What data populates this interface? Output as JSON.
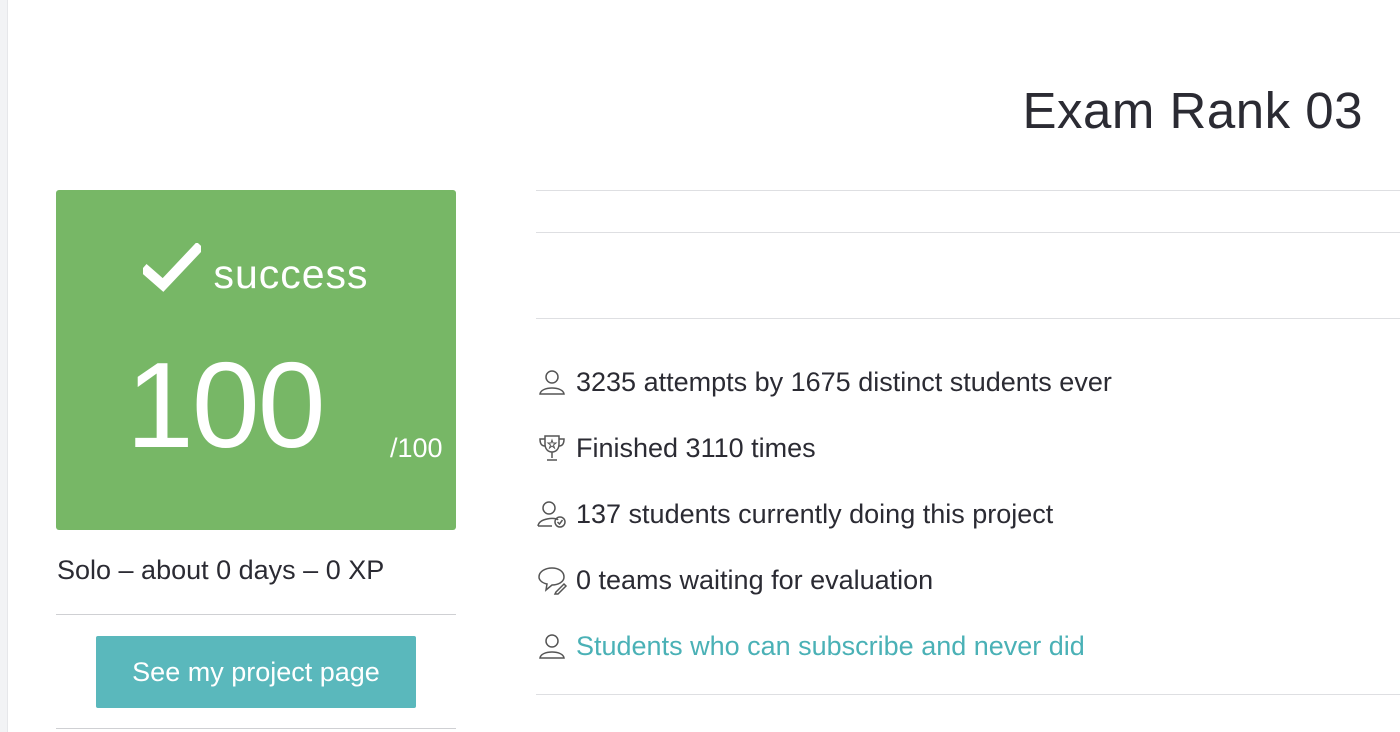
{
  "page": {
    "title": "Exam Rank 03"
  },
  "grade": {
    "status": "success",
    "score": "100",
    "max_score": "/100",
    "accent_color": "#77b766"
  },
  "project": {
    "meta": "Solo – about 0 days – 0 XP",
    "button_label": "See my project page",
    "button_color": "#5ab8bc"
  },
  "stats": [
    {
      "icon": "user-icon",
      "text": "3235 attempts by 1675 distinct students ever"
    },
    {
      "icon": "trophy-icon",
      "text": "Finished 3110 times"
    },
    {
      "icon": "user-check-icon",
      "text": "137 students currently doing this project"
    },
    {
      "icon": "chat-bubbles-icon",
      "text": "0 teams waiting for evaluation"
    },
    {
      "icon": "user-icon",
      "text": "Students who can subscribe and never did",
      "link_color": "#4ab1b6"
    }
  ]
}
